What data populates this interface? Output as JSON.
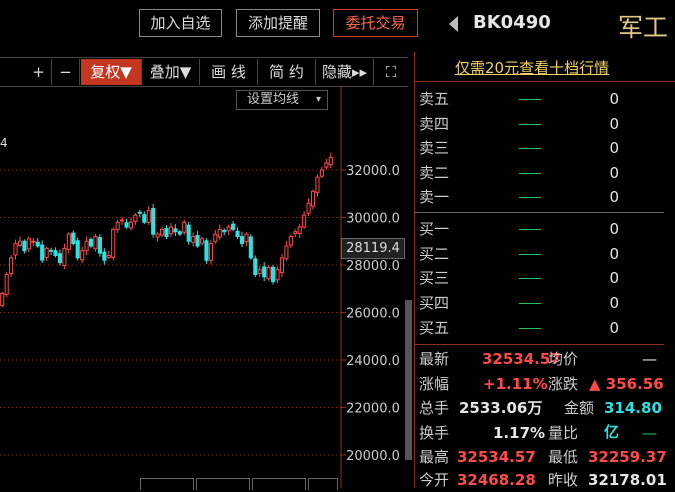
{
  "topbar": {
    "add_watchlist": "加入自选",
    "add_alert": "添加提醒",
    "trade": "委托交易",
    "code": "BK0490",
    "name": "军工"
  },
  "toolbar": {
    "zoom_in": "+",
    "zoom_out": "−",
    "adjust": "复权▼",
    "overlay": "叠加▼",
    "draw": "画 线",
    "simple": "简 约",
    "hide": "隐藏▸▸",
    "fullscreen": "⛶"
  },
  "chart": {
    "avg_settings": "设置均线",
    "corner_label": "4",
    "current_price_tag": "28119.4",
    "y_ticks": [
      "32000.0",
      "30000.0",
      "28000.0",
      "26000.0",
      "24000.0",
      "22000.0",
      "20000.0"
    ]
  },
  "chart_data": {
    "type": "candlestick",
    "ylim": [
      19500,
      33000
    ],
    "y_ticks": [
      32000,
      30000,
      28000,
      26000,
      24000,
      22000,
      20000
    ],
    "series_close": [
      26800,
      27600,
      28300,
      28900,
      29000,
      28600,
      29100,
      29000,
      28800,
      28200,
      28700,
      28600,
      28400,
      28100,
      28700,
      29300,
      28900,
      28300,
      28600,
      29000,
      28800,
      29200,
      28500,
      28200,
      28400,
      29500,
      29800,
      29900,
      29600,
      29800,
      30100,
      30200,
      29800,
      30300,
      29300,
      29300,
      29500,
      29200,
      29600,
      29400,
      29300,
      29800,
      29000,
      29200,
      28800,
      29100,
      28200,
      28900,
      29300,
      29500,
      29400,
      29600,
      29500,
      29200,
      28900,
      29300,
      28300,
      27600,
      27800,
      27500,
      27900,
      27300,
      27800,
      28300,
      28800,
      29200,
      29400,
      29600,
      30100,
      30600,
      31100,
      31700,
      32000,
      32300,
      32534
    ]
  },
  "quote": {
    "notice": "仅需20元查看十档行情",
    "sell": [
      "卖五",
      "卖四",
      "卖三",
      "卖二",
      "卖一"
    ],
    "buy": [
      "买一",
      "买二",
      "买三",
      "买四",
      "买五"
    ],
    "vol": [
      "0",
      "0",
      "0",
      "0",
      "0",
      "0",
      "0",
      "0",
      "0",
      "0"
    ],
    "latest_lbl": "最新",
    "latest": "32534.57",
    "avg_lbl": "均价",
    "avg": "—",
    "chg_pct_lbl": "涨幅",
    "chg_pct": "+1.11%",
    "chg_lbl": "涨跌",
    "chg": "▲ 356.56",
    "vol_lbl": "总手",
    "volume": "2533.06万",
    "amt_lbl": "金额",
    "amount": "314.80亿",
    "turn_lbl": "换手",
    "turnover": "1.17%",
    "ratio_lbl": "量比",
    "ratio": "—",
    "high_lbl": "最高",
    "high": "32534.57",
    "low_lbl": "最低",
    "low": "32259.37",
    "open_lbl": "今开",
    "open": "32468.28",
    "prev_lbl": "昨收",
    "prev": "32178.01"
  },
  "colors": {
    "up": "#ff4a4a",
    "down": "#2fe0e0",
    "flat": "#24c064",
    "border": "#8b2e1e"
  }
}
